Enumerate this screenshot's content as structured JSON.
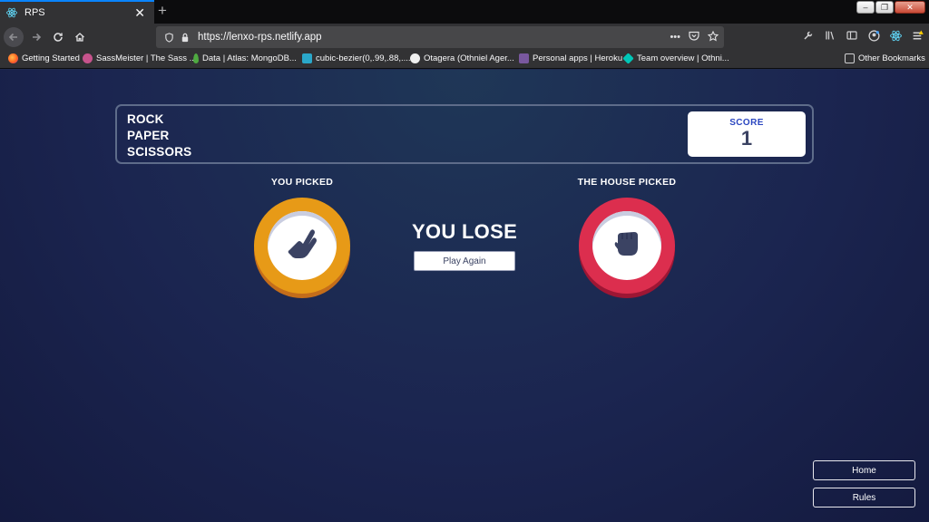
{
  "browser": {
    "tab_title": "RPS",
    "url": "https://lenxo-rps.netlify.app",
    "bookmarks": [
      "Getting Started",
      "SassMeister | The Sass ...",
      "Data | Atlas: MongoDB...",
      "cubic-bezier(0,.99,.88,....",
      "Otagera (Othniel Ager...",
      "Personal apps | Heroku",
      "Team overview | Othni..."
    ],
    "other_bookmarks": "Other Bookmarks",
    "url_menu_dots": "•••"
  },
  "game": {
    "title_lines": [
      "ROCK",
      "PAPER",
      "SCISSORS"
    ],
    "score_label": "SCORE",
    "score_value": "1",
    "you_picked_label": "YOU PICKED",
    "house_picked_label": "THE HOUSE PICKED",
    "player_choice": "scissors",
    "house_choice": "rock",
    "result_text": "YOU LOSE",
    "play_again_label": "Play Again"
  },
  "nav": {
    "home_label": "Home",
    "rules_label": "Rules"
  },
  "colors": {
    "scissors": "#e79a17",
    "rock": "#dc2e4e",
    "score_label": "#2a46c0",
    "background": "#1b2550"
  }
}
